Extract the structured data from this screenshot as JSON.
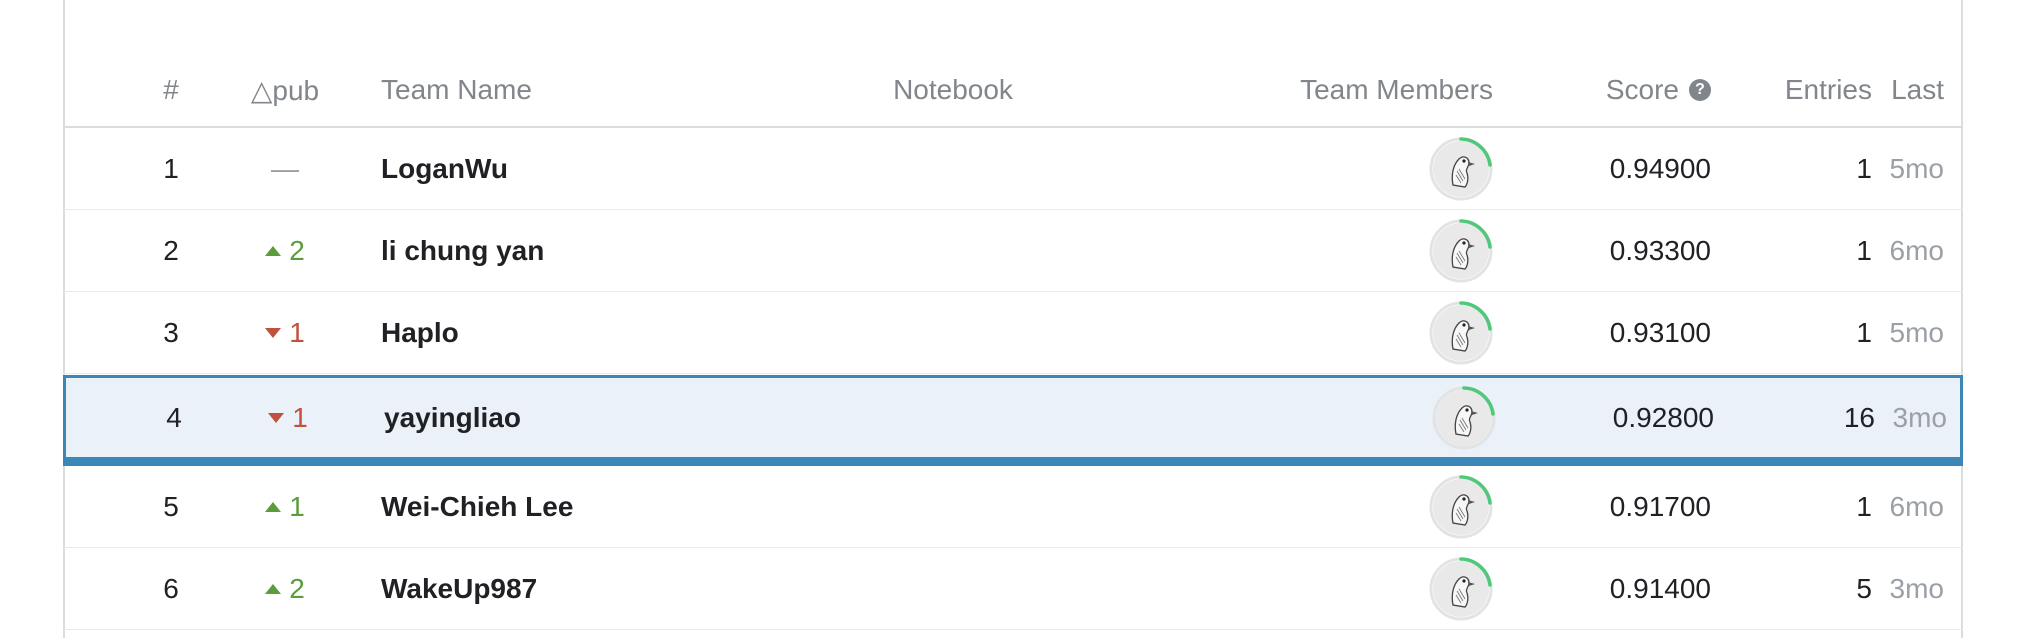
{
  "header": {
    "rank": "#",
    "delta": "△pub",
    "team_name": "Team Name",
    "notebook": "Notebook",
    "team_members": "Team Members",
    "score": "Score",
    "entries": "Entries",
    "last": "Last"
  },
  "colors": {
    "up": "#5b9c3b",
    "down": "#c0513f",
    "highlight_border": "#3b88b8",
    "highlight_bg": "#eaf1f8",
    "avatar_ring": "#4fc87a"
  },
  "rows": [
    {
      "rank": "1",
      "delta": "—",
      "dir": "none",
      "team": "LoganWu",
      "score": "0.94900",
      "entries": "1",
      "last": "5mo"
    },
    {
      "rank": "2",
      "delta": "2",
      "dir": "up",
      "team": "li chung yan",
      "score": "0.93300",
      "entries": "1",
      "last": "6mo"
    },
    {
      "rank": "3",
      "delta": "1",
      "dir": "down",
      "team": "Haplo",
      "score": "0.93100",
      "entries": "1",
      "last": "5mo"
    },
    {
      "rank": "4",
      "delta": "1",
      "dir": "down",
      "team": "yayingliao",
      "score": "0.92800",
      "entries": "16",
      "last": "3mo",
      "highlighted": true
    },
    {
      "rank": "5",
      "delta": "1",
      "dir": "up",
      "team": "Wei-Chieh Lee",
      "score": "0.91700",
      "entries": "1",
      "last": "6mo"
    },
    {
      "rank": "6",
      "delta": "2",
      "dir": "up",
      "team": "WakeUp987",
      "score": "0.91400",
      "entries": "5",
      "last": "3mo"
    }
  ]
}
